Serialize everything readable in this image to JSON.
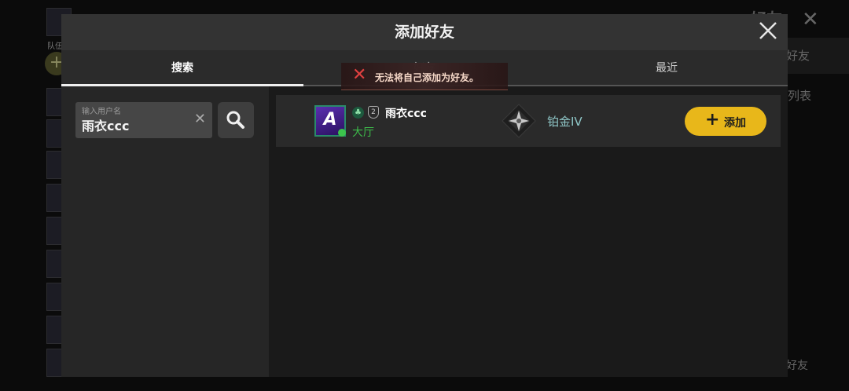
{
  "background": {
    "team_label": "队伍",
    "title": "好友",
    "tab_label": "好友",
    "list_label": "列表",
    "add_friend_label": "好友"
  },
  "modal": {
    "title": "添加好友",
    "close_icon": "close-icon"
  },
  "tabs": [
    {
      "label": "搜索",
      "active": true
    },
    {
      "label": "好友",
      "active": false
    },
    {
      "label": "最近",
      "active": false
    }
  ],
  "search": {
    "placeholder": "输入用户名",
    "value": "雨衣ccc",
    "clear_icon": "clear-icon",
    "search_icon": "search-icon"
  },
  "result": {
    "name": "雨衣ccc",
    "status": "大厅",
    "level_badge": "2",
    "rank": "铂金IV",
    "add_label": "添加"
  },
  "toast": {
    "text": "无法将自己添加为好友。",
    "icon": "error-x-icon"
  },
  "colors": {
    "accent": "#e8b71a",
    "online": "#3dbb4a",
    "error": "#e04040"
  }
}
